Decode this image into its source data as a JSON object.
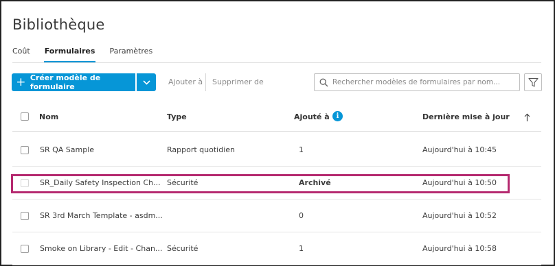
{
  "page": {
    "title": "Bibliothèque"
  },
  "tabs": [
    {
      "label": "Coût"
    },
    {
      "label": "Formulaires",
      "active": true
    },
    {
      "label": "Paramètres"
    }
  ],
  "toolbar": {
    "create_label": "Créer modèle de formulaire",
    "add_to_label": "Ajouter à",
    "remove_from_label": "Supprimer de"
  },
  "search": {
    "placeholder": "Rechercher modèles de formulaires par nom...",
    "value": ""
  },
  "table": {
    "headers": {
      "name": "Nom",
      "type": "Type",
      "added_to": "Ajouté à",
      "last_update": "Dernière mise à jour"
    },
    "rows": [
      {
        "name": "SR QA Sample",
        "type": "Rapport quotidien",
        "added_to": "1",
        "last_update": "Aujourd'hui à 10:45"
      },
      {
        "name": "SR_Daily Safety Inspection Ch...",
        "type": "Sécurité",
        "added_to": "Archivé",
        "last_update": "Aujourd'hui à 10:50"
      },
      {
        "name": "SR 3rd March Template - asdm...",
        "type": "",
        "added_to": "0",
        "last_update": "Aujourd'hui à 10:52"
      },
      {
        "name": "Smoke on Library - Edit - Chan...",
        "type": "Sécurité",
        "added_to": "1",
        "last_update": "Aujourd'hui à 10:58"
      }
    ]
  },
  "colors": {
    "accent": "#0696d7",
    "highlight": "#b5296f",
    "link": "#1a6fb1"
  }
}
